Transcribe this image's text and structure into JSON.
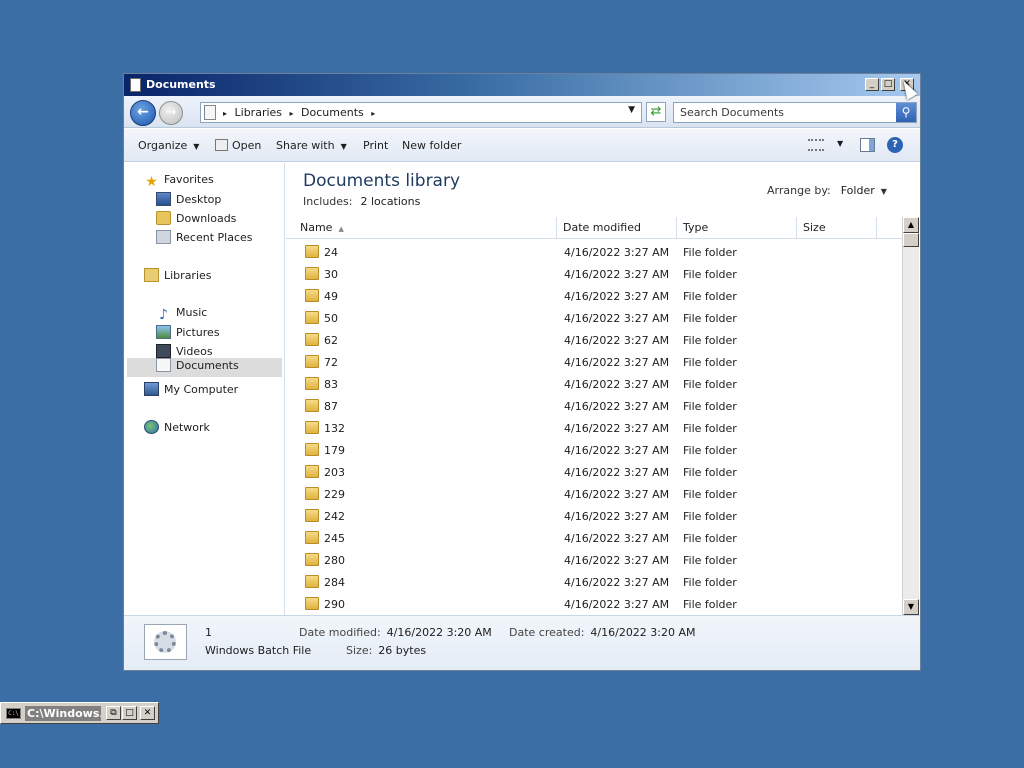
{
  "window": {
    "title": "Documents",
    "min_glyph": "_",
    "max_glyph": "□",
    "close_glyph": "✕"
  },
  "nav": {
    "back_glyph": "←",
    "forward_glyph": "→",
    "breadcrumb": [
      "Libraries",
      "Documents"
    ],
    "search_placeholder": "Search Documents"
  },
  "toolbar": {
    "organize": "Organize",
    "open": "Open",
    "share_with": "Share with",
    "print": "Print",
    "new_folder": "New folder"
  },
  "sidebar": {
    "favorites": "Favorites",
    "desktop": "Desktop",
    "downloads": "Downloads",
    "recent_places": "Recent Places",
    "libraries": "Libraries",
    "documents": "Documents",
    "music": "Music",
    "pictures": "Pictures",
    "videos": "Videos",
    "my_computer": "My Computer",
    "network": "Network"
  },
  "library": {
    "title": "Documents library",
    "includes_label": "Includes:",
    "locations": "2 locations",
    "arrange_label": "Arrange by:",
    "arrange_value": "Folder"
  },
  "columns": {
    "name": "Name",
    "date_modified": "Date modified",
    "type": "Type",
    "size": "Size"
  },
  "files": [
    {
      "name": "24",
      "date": "4/16/2022 3:27 AM",
      "type": "File folder"
    },
    {
      "name": "30",
      "date": "4/16/2022 3:27 AM",
      "type": "File folder"
    },
    {
      "name": "49",
      "date": "4/16/2022 3:27 AM",
      "type": "File folder"
    },
    {
      "name": "50",
      "date": "4/16/2022 3:27 AM",
      "type": "File folder"
    },
    {
      "name": "62",
      "date": "4/16/2022 3:27 AM",
      "type": "File folder"
    },
    {
      "name": "72",
      "date": "4/16/2022 3:27 AM",
      "type": "File folder"
    },
    {
      "name": "83",
      "date": "4/16/2022 3:27 AM",
      "type": "File folder"
    },
    {
      "name": "87",
      "date": "4/16/2022 3:27 AM",
      "type": "File folder"
    },
    {
      "name": "132",
      "date": "4/16/2022 3:27 AM",
      "type": "File folder"
    },
    {
      "name": "179",
      "date": "4/16/2022 3:27 AM",
      "type": "File folder"
    },
    {
      "name": "203",
      "date": "4/16/2022 3:27 AM",
      "type": "File folder"
    },
    {
      "name": "229",
      "date": "4/16/2022 3:27 AM",
      "type": "File folder"
    },
    {
      "name": "242",
      "date": "4/16/2022 3:27 AM",
      "type": "File folder"
    },
    {
      "name": "245",
      "date": "4/16/2022 3:27 AM",
      "type": "File folder"
    },
    {
      "name": "280",
      "date": "4/16/2022 3:27 AM",
      "type": "File folder"
    },
    {
      "name": "284",
      "date": "4/16/2022 3:27 AM",
      "type": "File folder"
    },
    {
      "name": "290",
      "date": "4/16/2022 3:27 AM",
      "type": "File folder"
    }
  ],
  "details": {
    "name": "1",
    "type": "Windows Batch File",
    "modified_label": "Date modified:",
    "modified_value": "4/16/2022 3:20 AM",
    "created_label": "Date created:",
    "created_value": "4/16/2022 3:20 AM",
    "size_label": "Size:",
    "size_value": "26 bytes"
  },
  "taskbar": {
    "cmd_label": "C:\\Windows...",
    "cmd_icon_text": "C:\\"
  },
  "icons": {
    "help_glyph": "?",
    "search_glyph": "⚲",
    "refresh_glyph": "⇄",
    "dropdown_glyph": "▼",
    "sort_glyph": "▲",
    "star_glyph": "★",
    "music_glyph": "♪"
  },
  "colors": {
    "desktop": "#3a6ea5",
    "title_start": "#0a246a",
    "title_end": "#a6caf0",
    "selected": "#dcdcdc"
  }
}
